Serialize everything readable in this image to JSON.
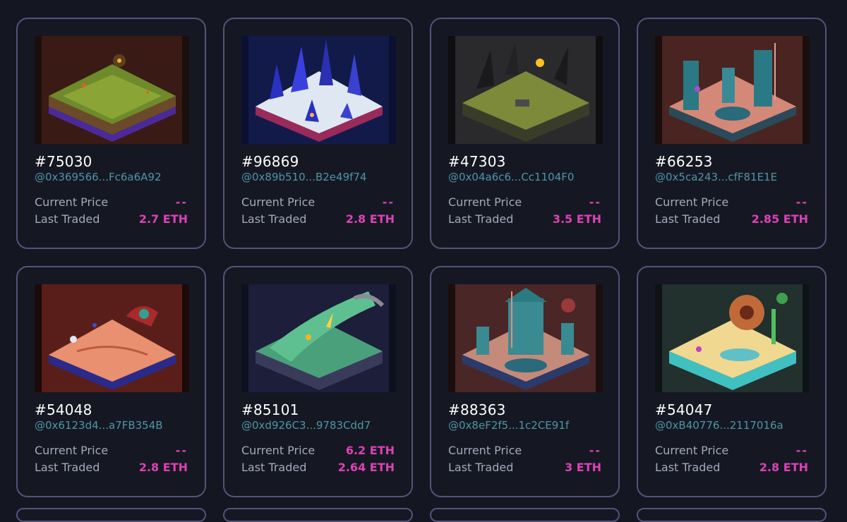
{
  "labels": {
    "current_price": "Current Price",
    "last_traded": "Last Traded"
  },
  "colors": {
    "background": "#141722",
    "card_border": "#55527a",
    "owner_link": "#4e95a8",
    "price": "#e040b8",
    "label": "#a4a8bb"
  },
  "cards": [
    {
      "id": "#75030",
      "owner": "@0x369566...Fc6a6A92",
      "current_price": "--",
      "last_traded": "2.7 ETH",
      "theme": "forest-tile"
    },
    {
      "id": "#96869",
      "owner": "@0x89b510...B2e49f74",
      "current_price": "--",
      "last_traded": "2.8 ETH",
      "theme": "ice-crystal-tile"
    },
    {
      "id": "#47303",
      "owner": "@0x04a6c6...Cc1104F0",
      "current_price": "--",
      "last_traded": "3.5 ETH",
      "theme": "dark-spike-tile"
    },
    {
      "id": "#66253",
      "owner": "@0x5ca243...cfF81E1E",
      "current_price": "--",
      "last_traded": "2.85 ETH",
      "theme": "cavern-tile"
    },
    {
      "id": "#54048",
      "owner": "@0x6123d4...a7FB354B",
      "current_price": "--",
      "last_traded": "2.8 ETH",
      "theme": "desert-tile"
    },
    {
      "id": "#85101",
      "owner": "@0xd926C3...9783Cdd7",
      "current_price": "6.2 ETH",
      "last_traded": "2.64 ETH",
      "theme": "emerald-wave-tile"
    },
    {
      "id": "#88363",
      "owner": "@0x8eF2f5...1c2CE91f",
      "current_price": "--",
      "last_traded": "3 ETH",
      "theme": "mushroom-temple-tile"
    },
    {
      "id": "#54047",
      "owner": "@0xB40776...2117016a",
      "current_price": "--",
      "last_traded": "2.8 ETH",
      "theme": "oasis-tile"
    }
  ]
}
